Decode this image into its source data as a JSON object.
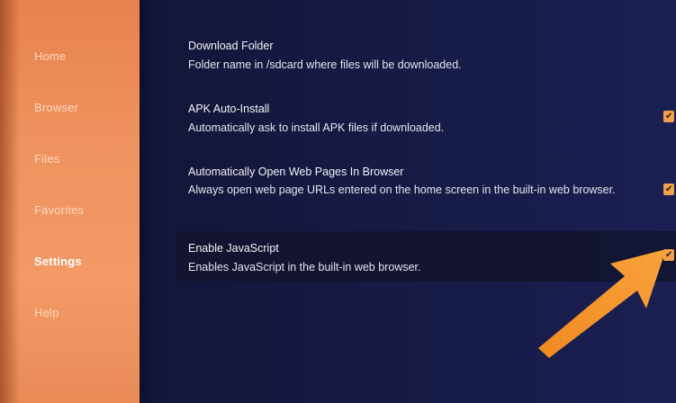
{
  "sidebar": {
    "items": [
      {
        "label": "Home"
      },
      {
        "label": "Browser"
      },
      {
        "label": "Files"
      },
      {
        "label": "Favorites"
      },
      {
        "label": "Settings",
        "selected": true
      },
      {
        "label": "Help"
      }
    ]
  },
  "settings": {
    "rows": [
      {
        "title": "Download Folder",
        "description": "Folder name in /sdcard where files will be downloaded."
      },
      {
        "title": "APK Auto-Install",
        "description": "Automatically ask to install APK files if downloaded.",
        "checked": true
      },
      {
        "title": "Automatically Open Web Pages In Browser",
        "description": "Always open web page URLs entered on the home screen in the built-in web browser.",
        "checked": true
      },
      {
        "title": "Enable JavaScript",
        "description": "Enables JavaScript in the built-in web browser.",
        "checked": true,
        "focused": true
      }
    ]
  },
  "colors": {
    "sidebar": "#ef925f",
    "background": "#161a44",
    "checkbox": "#f3a04a",
    "arrow": "#f6932a"
  },
  "icons": {
    "checkbox_check": "check-icon",
    "annotation_arrow": "arrow-icon"
  }
}
